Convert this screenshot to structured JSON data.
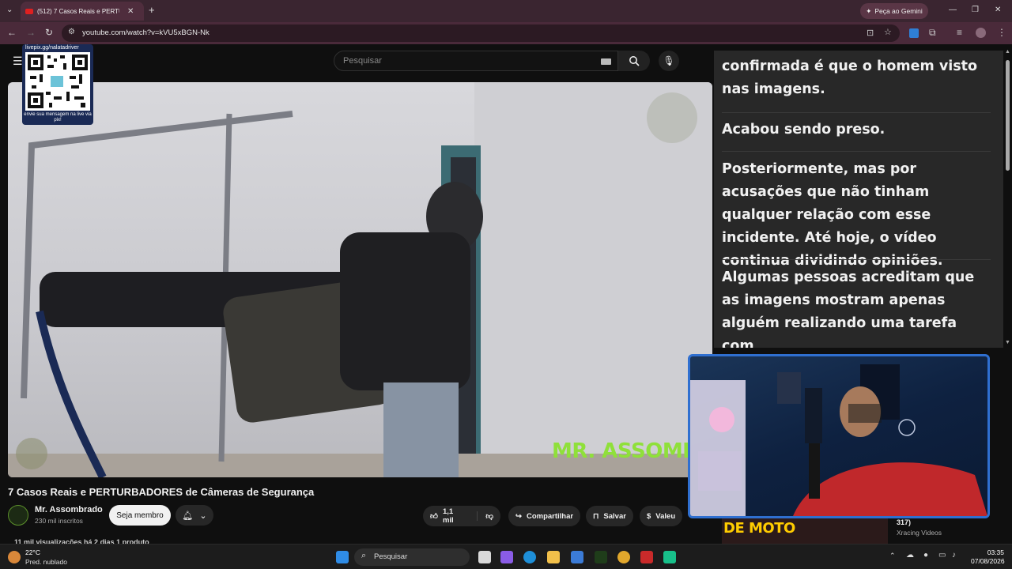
{
  "browser": {
    "tab_title": "(512) 7 Casos Reais e PERTU",
    "url": "youtube.com/watch?v=kVU5xBGN-Nk",
    "gemini_label": "Peça ao Gemini"
  },
  "youtube": {
    "search_placeholder": "Pesquisar",
    "overlay_qr": {
      "top_text": "livepix.gg/nalatadriver",
      "bottom_text": "envie sua mensagem na live via pix!"
    },
    "video": {
      "watermark": "MR. ASSOMBRAD",
      "title": "7 Casos Reais e PERTURBADORES de Câmeras de Segurança"
    },
    "channel": {
      "name": "Mr. Assombrado",
      "subscribers": "230 mil inscritos",
      "join_label": "Seja membro"
    },
    "actions": {
      "likes": "1,1 mil",
      "share": "Compartilhar",
      "save": "Salvar",
      "thanks": "Valeu"
    },
    "views_line": "11 mil visualizações  há 2 dias  1 produto",
    "transcript": [
      "confirmada é que o homem visto nas imagens.",
      "Acabou sendo preso.",
      "Posteriormente, mas por acusações que não tinham qualquer relação com esse incidente. Até hoje, o vídeo continua dividindo opiniões.",
      "Algumas pessoas acreditam que as imagens mostram apenas alguém realizando uma tarefa com"
    ],
    "recommendation": {
      "thumb_text": "DE MOTO",
      "title_fragment": "317)",
      "channel": "Xracing Videos"
    }
  },
  "taskbar": {
    "temperature": "22°C",
    "weather": "Pred. nublado",
    "search_label": "Pesquisar",
    "time": "03:35",
    "date": "07/08/2026"
  },
  "colors": {
    "tab_bar": "#3a2530",
    "address_bar": "#4a2a3a",
    "watermark": "#8fe03a",
    "webcam_border": "#2f6fd0"
  }
}
